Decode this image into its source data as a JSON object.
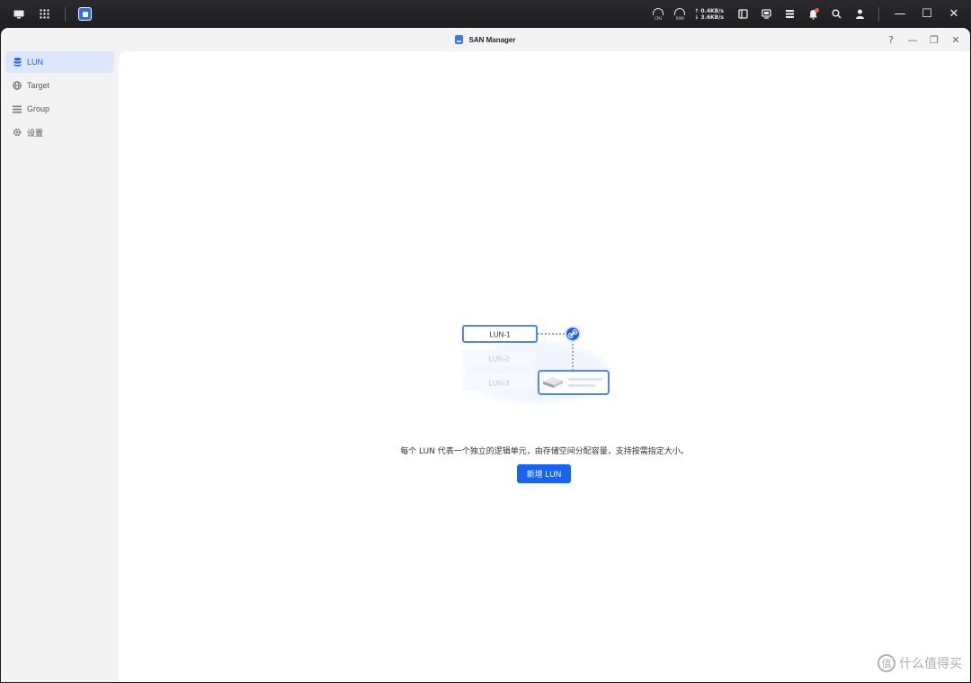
{
  "window": {
    "title": "SAN Manager"
  },
  "os_bar": {
    "cpu_label": "CPU",
    "ram_label": "RAM",
    "net_up": "↑ 0.4KB/s",
    "net_down": "↓ 3.6KB/s"
  },
  "titlebar": {
    "help_label": "?",
    "minimize_label": "—",
    "restore_label": "❐",
    "close_label": "✕"
  },
  "sidebar": {
    "items": [
      {
        "label": "LUN",
        "icon": "database-icon",
        "active": true
      },
      {
        "label": "Target",
        "icon": "globe-icon",
        "active": false
      },
      {
        "label": "Group",
        "icon": "list-icon",
        "active": false
      },
      {
        "label": "设置",
        "icon": "gear-icon",
        "active": false
      }
    ]
  },
  "empty_state": {
    "illustration": {
      "lun1": "LUN-1",
      "lun2": "LUN-2",
      "lun3": "LUN-3"
    },
    "description": "每个 LUN 代表一个独立的逻辑单元，由存储空间分配容量，支持按需指定大小。",
    "add_button": "新增 LUN"
  },
  "watermark": {
    "text": "什么值得买",
    "logo_char": "值"
  },
  "colors": {
    "accent": "#1664f0",
    "active_bg": "#dde7fb",
    "active_text": "#1f5fd6"
  }
}
